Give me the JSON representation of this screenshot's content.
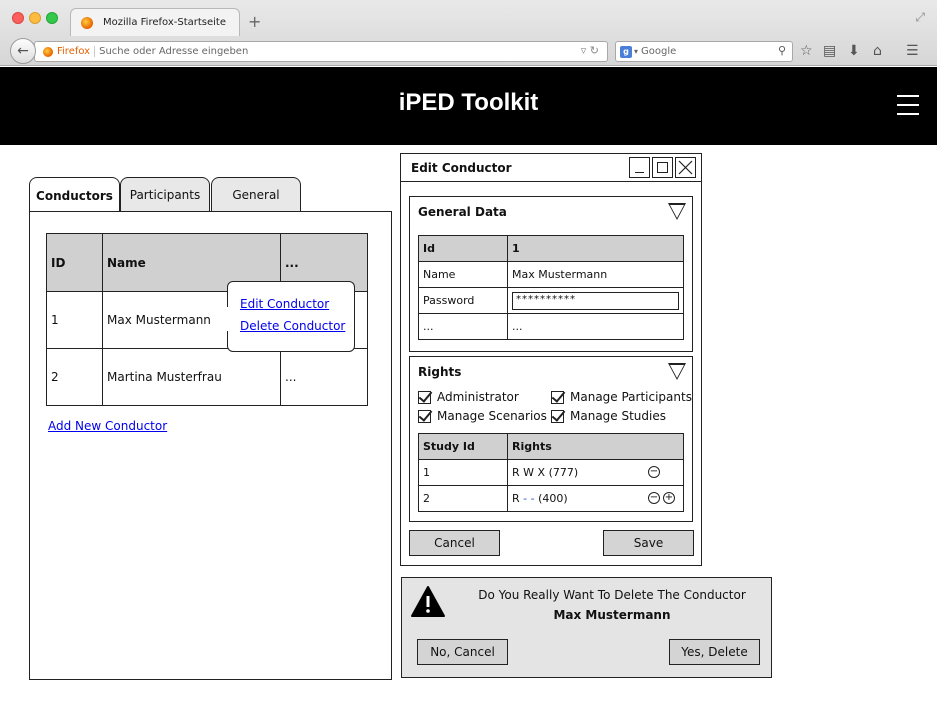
{
  "browser": {
    "tab_title": "Mozilla Firefox-Startseite",
    "newtab_label": "+",
    "url_prefix": "Firefox",
    "url_placeholder": "Suche oder Adresse eingeben",
    "search_engine_badge": "g",
    "search_placeholder": "Google"
  },
  "header": {
    "title": "iPED Toolkit"
  },
  "tabs": [
    {
      "label": "Conductors",
      "active": true
    },
    {
      "label": "Participants",
      "active": false
    },
    {
      "label": "General",
      "active": false
    }
  ],
  "conductors": {
    "columns": [
      "ID",
      "Name",
      "..."
    ],
    "rows": [
      {
        "id": "1",
        "name": "Max Mustermann",
        "more": ""
      },
      {
        "id": "2",
        "name": "Martina Musterfrau",
        "more": "..."
      }
    ],
    "add_link": "Add New Conductor"
  },
  "context_menu": {
    "edit": "Edit Conductor",
    "delete": "Delete Conductor"
  },
  "edit_window": {
    "title": "Edit Conductor",
    "general": {
      "title": "General Data",
      "rows": [
        {
          "label": "Id",
          "value": "1"
        },
        {
          "label": "Name",
          "value": "Max Mustermann"
        },
        {
          "label": "Password",
          "value": "**********"
        },
        {
          "label": "...",
          "value": "..."
        }
      ]
    },
    "rights": {
      "title": "Rights",
      "checkboxes": [
        "Administrator",
        "Manage Participants",
        "Manage Scenarios",
        "Manage Studies"
      ],
      "columns": [
        "Study Id",
        "Rights"
      ],
      "rows": [
        {
          "study_id": "1",
          "rights_prefix": "R W X",
          "rights_mode": "(777)"
        },
        {
          "study_id": "2",
          "rights_prefix": "R",
          "rights_dashes": "- -",
          "rights_mode": "(400)"
        }
      ],
      "minus": "−",
      "plus": "+"
    },
    "cancel_label": "Cancel",
    "save_label": "Save"
  },
  "confirm": {
    "message": "Do You Really Want To Delete The Conductor",
    "name": "Max Mustermann",
    "no_label": "No, Cancel",
    "yes_label": "Yes, Delete"
  }
}
